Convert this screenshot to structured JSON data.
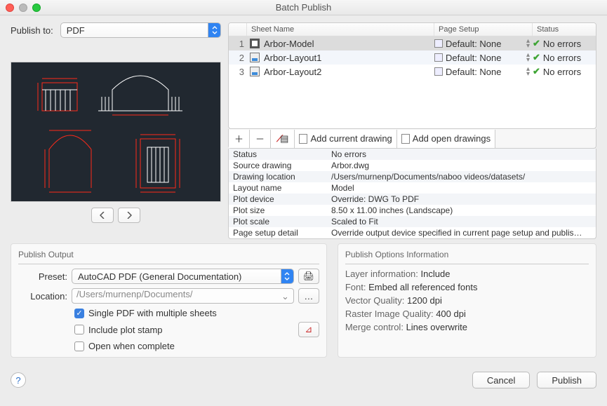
{
  "window": {
    "title": "Batch Publish"
  },
  "publish_to": {
    "label": "Publish to:",
    "value": "PDF"
  },
  "table": {
    "headers": {
      "sheet": "Sheet Name",
      "setup": "Page Setup",
      "status": "Status"
    },
    "rows": [
      {
        "n": "1",
        "name": "Arbor-Model",
        "setup": "Default: None",
        "status": "No errors",
        "kind": "model",
        "selected": true
      },
      {
        "n": "2",
        "name": "Arbor-Layout1",
        "setup": "Default: None",
        "status": "No errors",
        "kind": "layout",
        "selected": false
      },
      {
        "n": "3",
        "name": "Arbor-Layout2",
        "setup": "Default: None",
        "status": "No errors",
        "kind": "layout",
        "selected": false
      }
    ],
    "toolbar": {
      "add_current": "Add current drawing",
      "add_open": "Add open drawings"
    }
  },
  "details": [
    {
      "label": "Status",
      "value": "No errors"
    },
    {
      "label": "Source drawing",
      "value": "Arbor.dwg"
    },
    {
      "label": "Drawing location",
      "value": "/Users/murnenp/Documents/naboo videos/datasets/"
    },
    {
      "label": "Layout name",
      "value": "Model"
    },
    {
      "label": "Plot device",
      "value": "Override: DWG To PDF"
    },
    {
      "label": "Plot size",
      "value": "8.50 x 11.00 inches (Landscape)"
    },
    {
      "label": "Plot scale",
      "value": "Scaled to Fit"
    },
    {
      "label": "Page setup detail",
      "value": "Override output device specified in current page setup and publis…"
    }
  ],
  "output": {
    "title": "Publish Output",
    "preset_label": "Preset:",
    "preset_value": "AutoCAD PDF (General Documentation)",
    "location_label": "Location:",
    "location_value": "/Users/murnenp/Documents/",
    "single_pdf": "Single PDF with multiple sheets",
    "plot_stamp": "Include plot stamp",
    "open_complete": "Open when complete"
  },
  "options": {
    "title": "Publish Options Information",
    "rows": [
      {
        "label": "Layer information:",
        "value": "Include"
      },
      {
        "label": "Font:",
        "value": "Embed all referenced fonts"
      },
      {
        "label": "Vector Quality:",
        "value": "1200 dpi"
      },
      {
        "label": "Raster Image Quality:",
        "value": "400 dpi"
      },
      {
        "label": "Merge control:",
        "value": "Lines overwrite"
      }
    ]
  },
  "footer": {
    "cancel": "Cancel",
    "publish": "Publish"
  }
}
